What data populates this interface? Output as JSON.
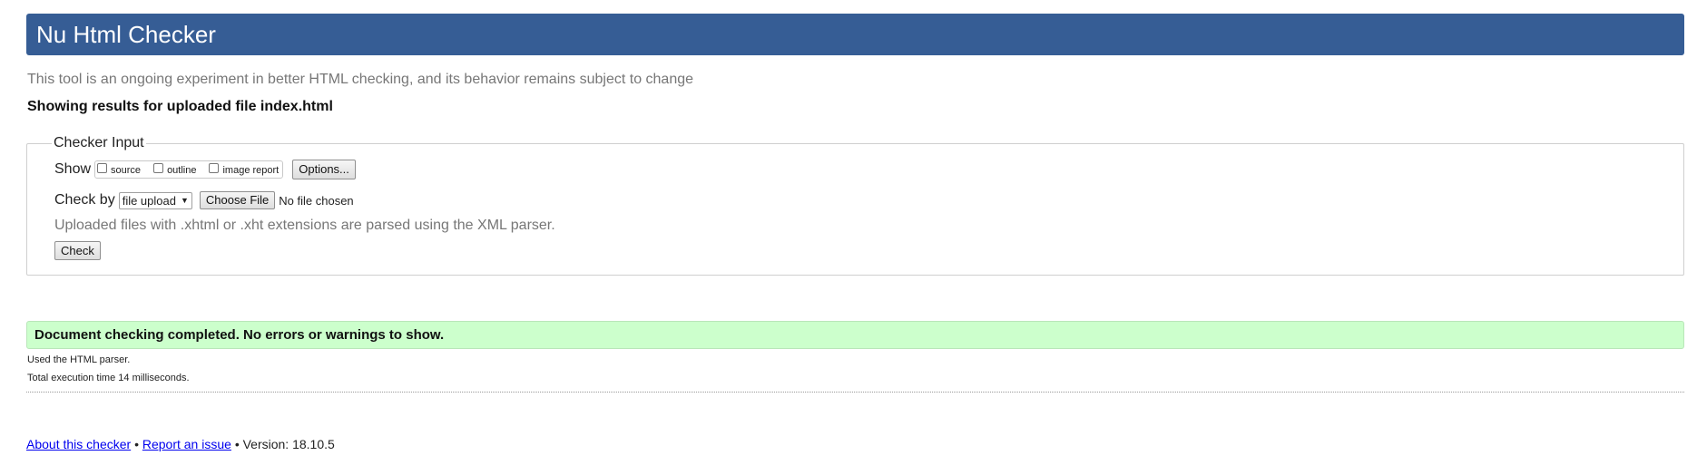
{
  "header": {
    "title": "Nu Html Checker"
  },
  "tagline": "This tool is an ongoing experiment in better HTML checking, and its behavior remains subject to change",
  "results_heading": "Showing results for uploaded file index.html",
  "checker_input": {
    "legend": "Checker Input",
    "show_label": "Show",
    "show_options": [
      {
        "label": "source",
        "checked": false
      },
      {
        "label": "outline",
        "checked": false
      },
      {
        "label": "image report",
        "checked": false
      }
    ],
    "options_button": "Options...",
    "check_by_label": "Check by",
    "check_by_selected": "file upload",
    "choose_file_button": "Choose File",
    "no_file_text": "No file chosen",
    "xml_note": "Uploaded files with .xhtml or .xht extensions are parsed using the XML parser.",
    "check_button": "Check"
  },
  "result": {
    "success_message": "Document checking completed. No errors or warnings to show.",
    "parser_note": "Used the HTML parser.",
    "execution_time": "Total execution time 14 milliseconds."
  },
  "footer": {
    "about_link": "About this checker",
    "separator": "•",
    "report_link": "Report an issue",
    "version": "Version: 18.10.5"
  },
  "colors": {
    "header_bg": "#365d95",
    "success_bg": "#ccffcc",
    "link": "#0000ee"
  }
}
